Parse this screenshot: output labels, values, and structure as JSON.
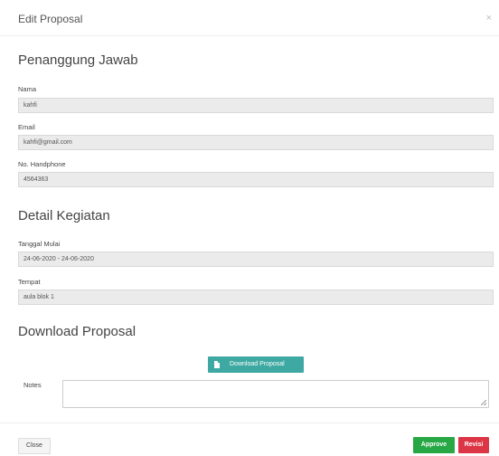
{
  "modal": {
    "title": "Edit Proposal",
    "close_symbol": "×"
  },
  "penanggung_jawab": {
    "section_title": "Penanggung Jawab",
    "nama_label": "Nama",
    "nama_value": "kahfi",
    "email_label": "Email",
    "email_value": "kahfi@gmail.com",
    "hp_label": "No. Handphone",
    "hp_value": "4564363"
  },
  "detail_kegiatan": {
    "section_title": "Detail Kegiatan",
    "tanggal_label": "Tanggal Mulai",
    "tanggal_value": "24-06-2020 - 24-06-2020",
    "tempat_label": "Tempat",
    "tempat_value": "aula blok 1"
  },
  "download": {
    "section_title": "Download Proposal",
    "button_label": "Download Proposal",
    "icon": "file-icon"
  },
  "notes": {
    "label": "Notes",
    "value": ""
  },
  "footer": {
    "close_label": "Close",
    "approve_label": "Approve",
    "revisi_label": "Revisi"
  },
  "colors": {
    "approve": "#28a745",
    "revisi": "#dc3545",
    "download": "#3ea9a2"
  }
}
